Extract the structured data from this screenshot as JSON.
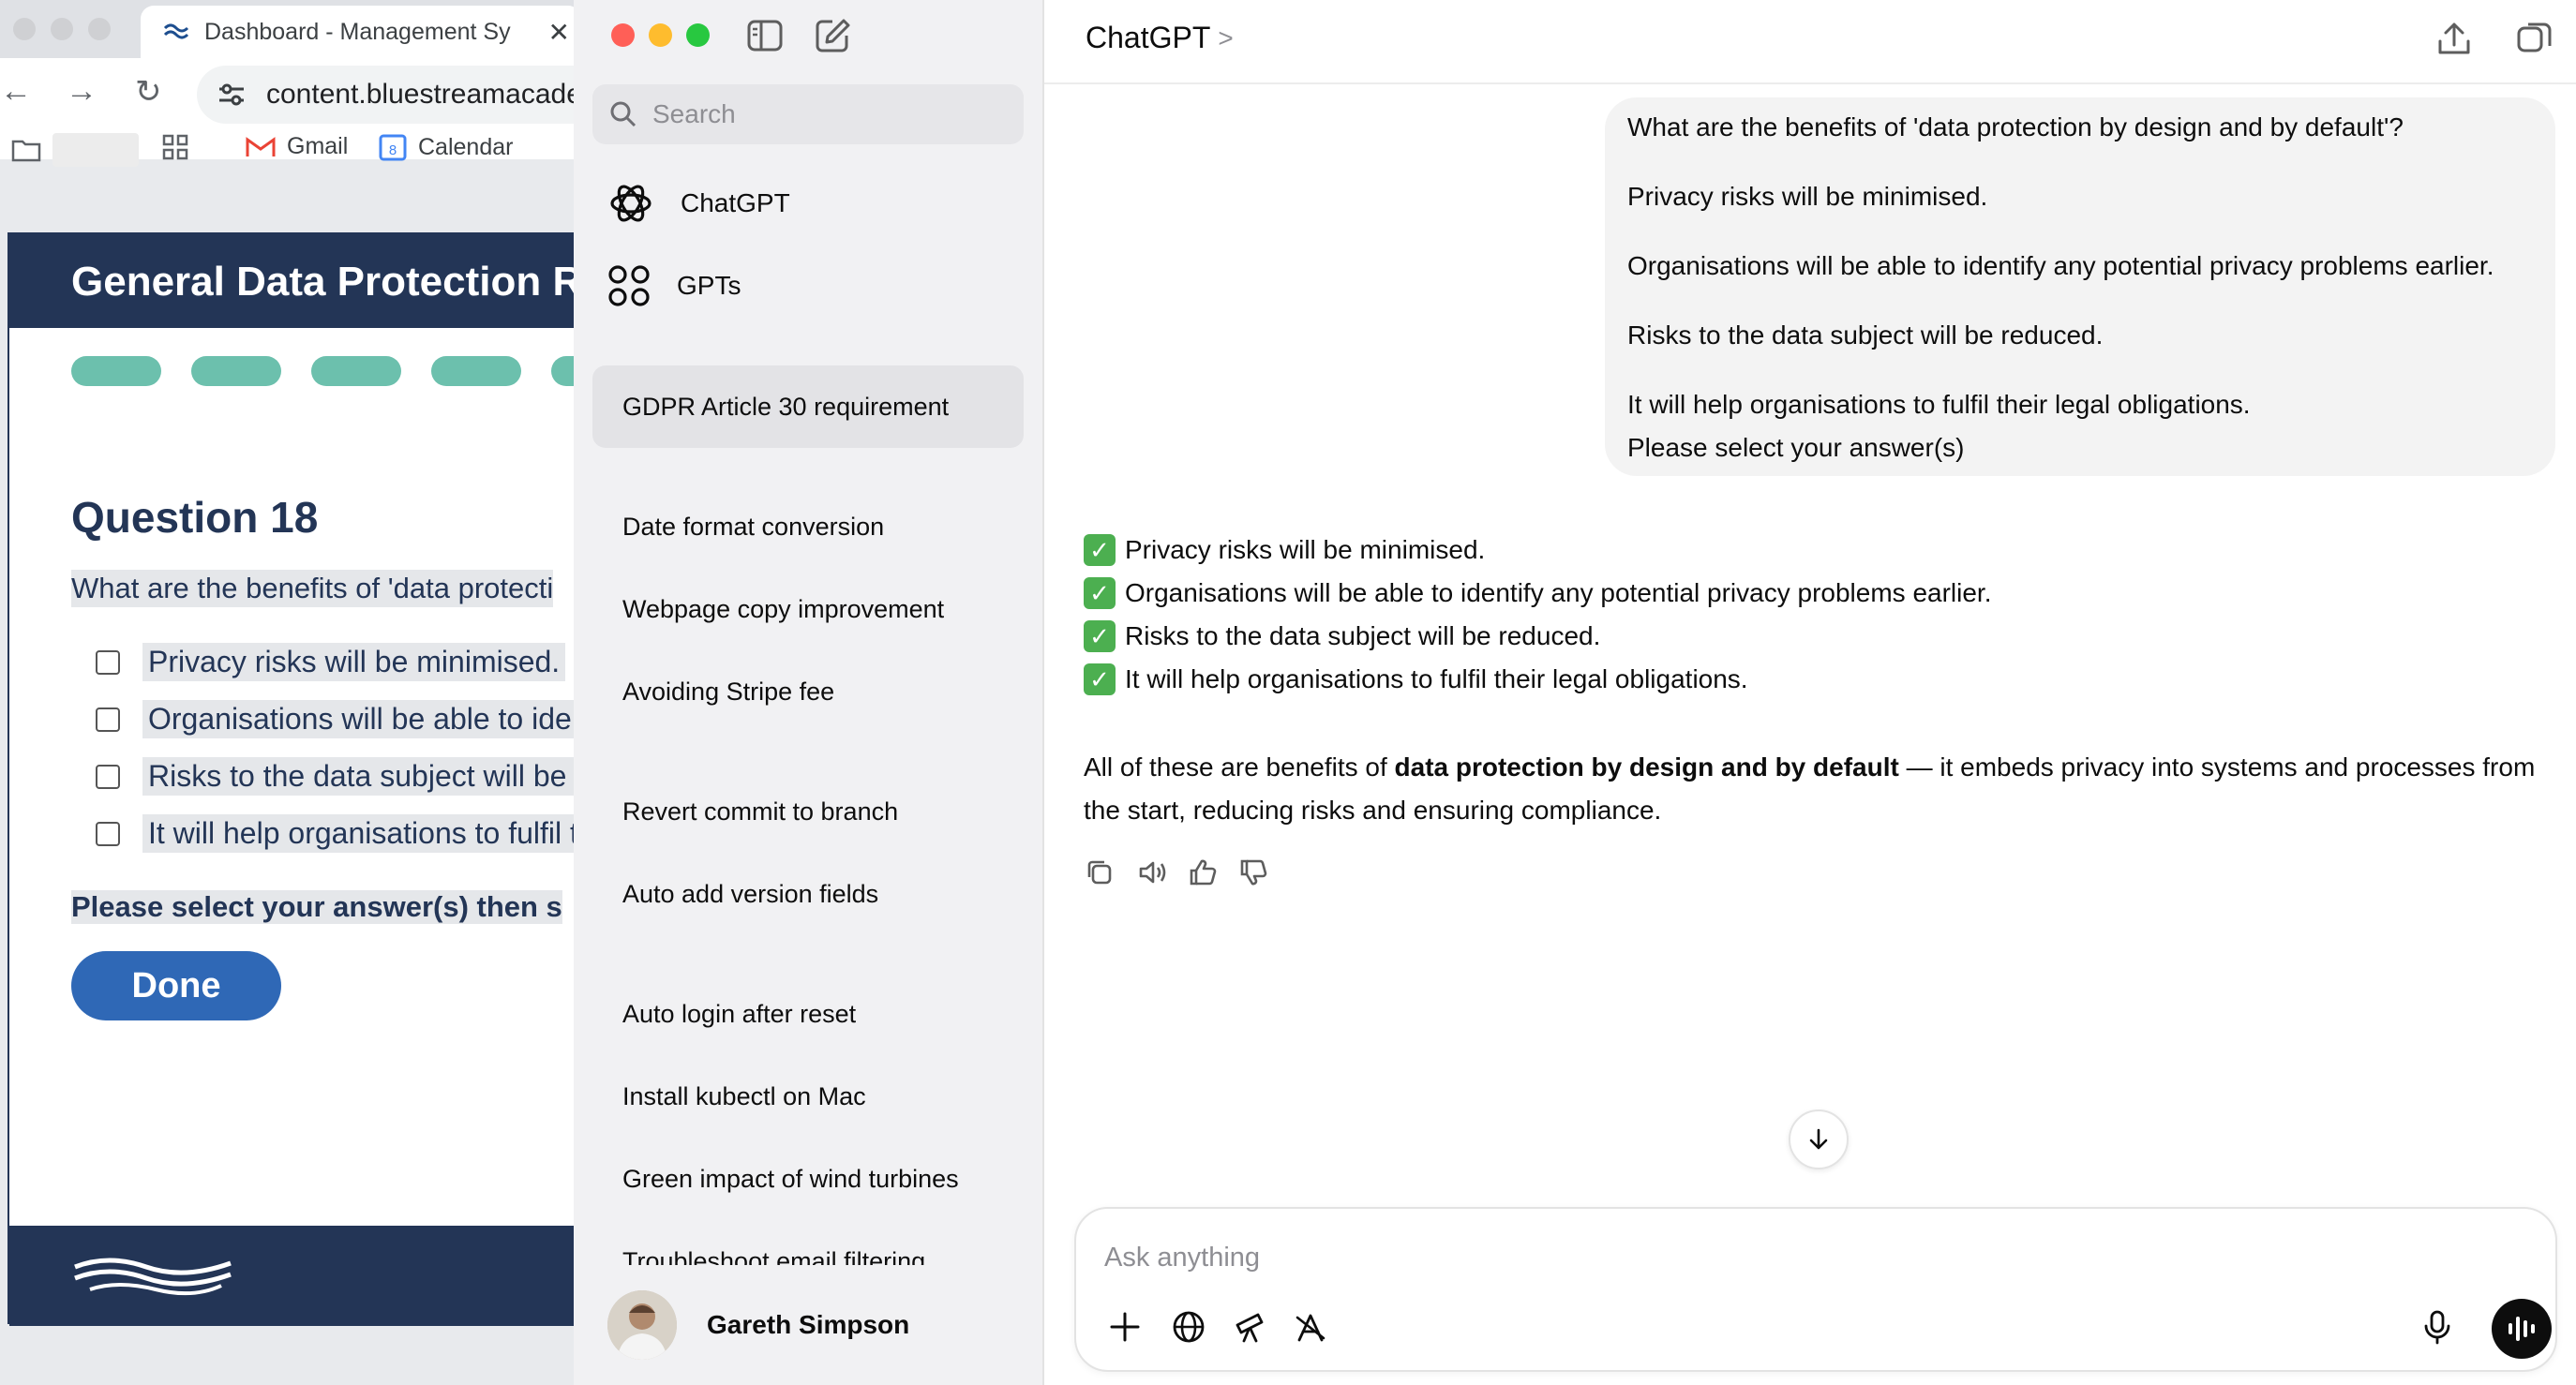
{
  "browser": {
    "tab_title": "Dashboard - Management Sy",
    "tab_close": "✕",
    "url": "content.bluestreamacade",
    "bookmarks": [
      {
        "label": "Gmail"
      },
      {
        "label": "Calendar"
      }
    ]
  },
  "course": {
    "header_title": "General Data Protection R",
    "question_title": "Question 18",
    "question_text": "What are the benefits of 'data protecti",
    "options": [
      "Privacy risks will be minimised.",
      "Organisations will be able to ider",
      "Risks to the data subject will be r",
      "It will help organisations to fulfil t"
    ],
    "instruction": "Please select your answer(s) then s",
    "done_label": "Done"
  },
  "sidebar": {
    "search_placeholder": "Search",
    "nav": [
      {
        "label": "ChatGPT",
        "icon": "openai-logo-icon"
      },
      {
        "label": "GPTs",
        "icon": "gpts-grid-icon"
      }
    ],
    "chats": [
      {
        "label": "GDPR Article 30 requirement",
        "active": true
      },
      {
        "label": "Date format conversion"
      },
      {
        "label": "Webpage copy improvement"
      },
      {
        "label": "Avoiding Stripe fee"
      },
      {
        "label": "Revert commit to branch"
      },
      {
        "label": "Auto add version fields"
      },
      {
        "label": "Auto login after reset"
      },
      {
        "label": "Install kubectl on Mac"
      },
      {
        "label": "Green impact of wind turbines"
      },
      {
        "label": "Troubleshoot email filtering"
      }
    ],
    "user_name": "Gareth Simpson"
  },
  "main": {
    "model_title": "ChatGPT",
    "model_chevron": ">",
    "user_message": [
      "What are the benefits of 'data protection by design and by default'?",
      "Privacy risks will be minimised.",
      "Organisations will be able to identify any potential privacy problems earlier.",
      "Risks to the data subject will be reduced.",
      "It will help organisations to fulfil their legal obligations.",
      "Please select your answer(s)"
    ],
    "assistant_checks": [
      "Privacy risks will be minimised.",
      "Organisations will be able to identify any potential privacy problems earlier.",
      "Risks to the data subject will be reduced.",
      "It will help organisations to fulfil their legal obligations."
    ],
    "check_mark": "✓",
    "summary_prefix": "All of these are benefits of ",
    "summary_bold": "data protection by design and by default",
    "summary_suffix": " — it embeds privacy into systems and processes from the start, reducing risks and ensuring compliance.",
    "composer_placeholder": "Ask anything"
  },
  "colors": {
    "course_navy": "#233556",
    "progress_green": "#6cc0ad",
    "done_blue": "#2f68b6",
    "check_green": "#4caf50",
    "sidebar_bg": "#f1f1f3",
    "user_bubble": "#f3f3f3"
  }
}
